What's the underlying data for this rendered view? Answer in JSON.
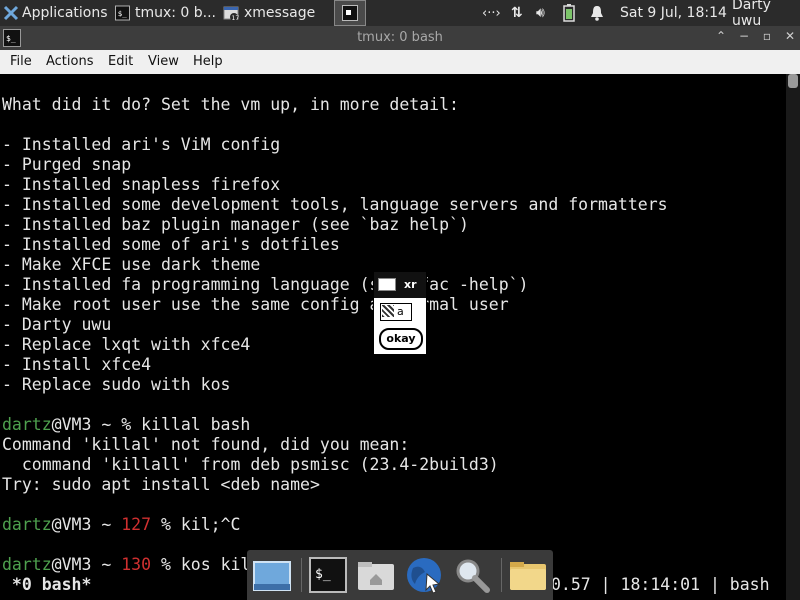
{
  "panel": {
    "apps_menu": "Applications",
    "tasks": [
      {
        "label": "tmux: 0 b..."
      },
      {
        "label": "xmessage"
      }
    ],
    "clock": "Sat  9 Jul, 18:14",
    "user": "Darty uwu"
  },
  "window": {
    "title": "tmux: 0 bash",
    "menus": [
      "File",
      "Actions",
      "Edit",
      "View",
      "Help"
    ]
  },
  "terminal": {
    "lines": [
      "What did it do? Set the vm up, in more detail:",
      "",
      "- Installed ari's ViM config",
      "- Purged snap",
      "- Installed snapless firefox",
      "- Installed some development tools, language servers and formatters",
      "- Installed baz plugin manager (see `baz help`)",
      "- Installed some of ari's dotfiles",
      "- Make XFCE use dark theme",
      "- Installed fa programming language (see `fac -help`)",
      "- Make root user use the same config as normal user",
      "- Darty uwu",
      "- Replace lxqt with xfce4",
      "- Install xfce4",
      "- Replace sudo with kos",
      "",
      "",
      "Command 'killal' not found, did you mean:",
      "  command 'killall' from deb psmisc (23.4-2build3)",
      "Try: sudo apt install <deb name>"
    ],
    "prompts": [
      {
        "user": "dartz",
        "host": "@VM3 ~ ",
        "code": "",
        "rest": "% killal bash"
      },
      {
        "user": "dartz",
        "host": "@VM3 ~ ",
        "code": "127",
        "rest": " % kil;^C"
      },
      {
        "user": "dartz",
        "host": "@VM3 ~ ",
        "code": "130",
        "rest": " % kos kil"
      }
    ],
    "tmux_left": " *0 bash*",
    "tmux_right": "0.57 | 18:14:01 | bash"
  },
  "xmessage": {
    "title": "xr",
    "label": "a",
    "button": "okay"
  },
  "dock": {
    "items": [
      "show-desktop",
      "terminal",
      "home-folder",
      "web-browser",
      "app-finder",
      "files"
    ]
  }
}
